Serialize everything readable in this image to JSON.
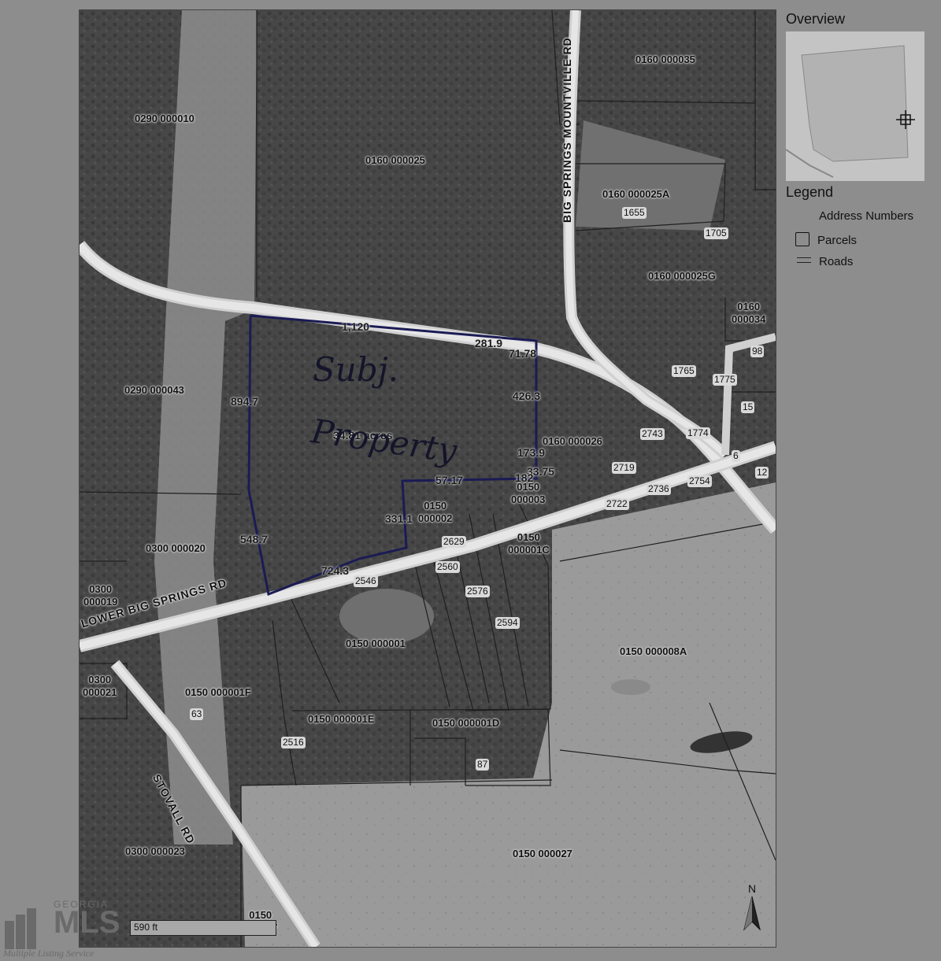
{
  "sidebar": {
    "overview_title": "Overview",
    "legend_title": "Legend",
    "legend_items": [
      {
        "label": "Address Numbers",
        "icon": "address-number-icon"
      },
      {
        "label": "Parcels",
        "icon": "parcel-box-icon"
      },
      {
        "label": "Roads",
        "icon": "road-line-icon"
      }
    ]
  },
  "parcels": [
    {
      "id": "0290 000010"
    },
    {
      "id": "0160 000025"
    },
    {
      "id": "0160 000035"
    },
    {
      "id": "0160 000025A"
    },
    {
      "id": "0160 000025G"
    },
    {
      "id": "0160\n000034"
    },
    {
      "id": "0290 000043"
    },
    {
      "id": "0160 000026"
    },
    {
      "id": "0150\n000003"
    },
    {
      "id": "0150\n000002"
    },
    {
      "id": "0150\n000001C"
    },
    {
      "id": "0300 000020"
    },
    {
      "id": "0300\n000019"
    },
    {
      "id": "0150 000001"
    },
    {
      "id": "0150 000008A"
    },
    {
      "id": "0300\n000021"
    },
    {
      "id": "0150 000001F"
    },
    {
      "id": "0150 000001E"
    },
    {
      "id": "0150 000001D"
    },
    {
      "id": "0300 000023"
    },
    {
      "id": "0150 000027"
    },
    {
      "id": "0150\n000047"
    }
  ],
  "address_numbers": [
    "1655",
    "1705",
    "98",
    "1765",
    "1775",
    "15",
    "2743",
    "1774",
    "6",
    "2719",
    "12",
    "2736",
    "2754",
    "2722",
    "2629",
    "2560",
    "2576",
    "2594",
    "2546",
    "63",
    "2516",
    "87"
  ],
  "roads": {
    "big_springs_mountville": "BIG SPRINGS MOUNTVILLE RD",
    "lower_big_springs": "LOWER BIG SPRINGS RD",
    "stovall": "STOVALL RD"
  },
  "measurements": [
    "1,120",
    "281.9",
    "71.78",
    "894.7",
    "426.3",
    "34.81 acres",
    "173.9",
    "33.75",
    "57.17",
    "182",
    "331.1",
    "548.7",
    "724.3"
  ],
  "handwriting": {
    "line1": "Subj.",
    "line2": "Property"
  },
  "scale": {
    "label": "590 ft"
  },
  "north": {
    "label": "N"
  },
  "watermark": {
    "top": "GEORGIA",
    "main": "MLS",
    "bottom": "Multiple Listing Service"
  }
}
